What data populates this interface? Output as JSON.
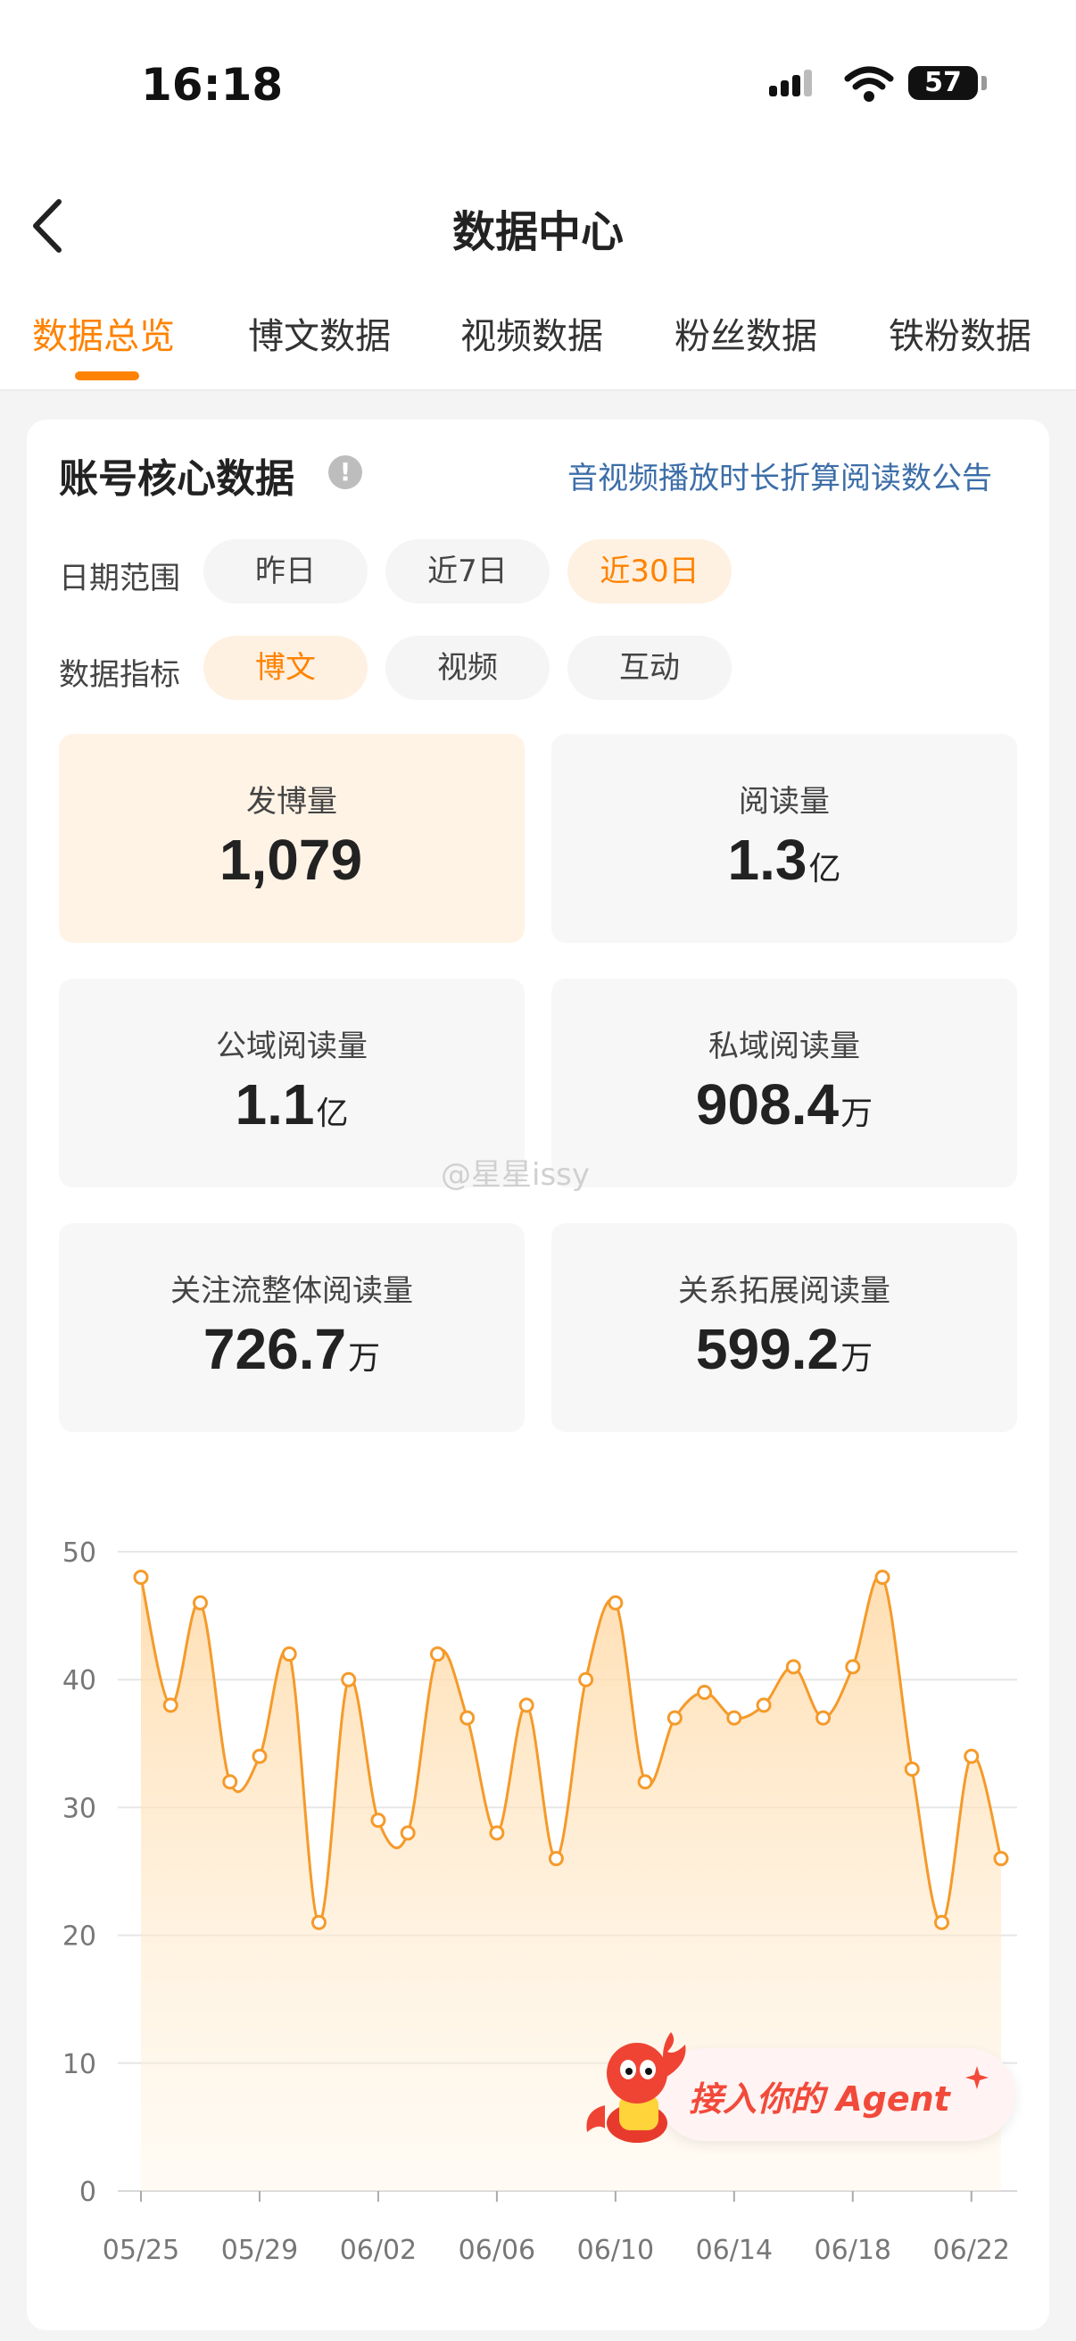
{
  "status": {
    "time": "16:18",
    "battery": "57"
  },
  "header": {
    "title": "数据中心"
  },
  "tabs": [
    {
      "label": "数据总览"
    },
    {
      "label": "博文数据"
    },
    {
      "label": "视频数据"
    },
    {
      "label": "粉丝数据"
    },
    {
      "label": "铁粉数据"
    }
  ],
  "section": {
    "title": "账号核心数据",
    "info_icon": "!",
    "notice": "音视频播放时长折算阅读数公告"
  },
  "filters": {
    "date_label": "日期范围",
    "date_options": [
      "昨日",
      "近7日",
      "近30日"
    ],
    "metric_label": "数据指标",
    "metric_options": [
      "博文",
      "视频",
      "互动"
    ]
  },
  "metrics": [
    {
      "label": "发博量",
      "value": "1,079",
      "unit": ""
    },
    {
      "label": "阅读量",
      "value": "1.3",
      "unit": "亿"
    },
    {
      "label": "公域阅读量",
      "value": "1.1",
      "unit": "亿"
    },
    {
      "label": "私域阅读量",
      "value": "908.4",
      "unit": "万"
    },
    {
      "label": "关注流整体阅读量",
      "value": "726.7",
      "unit": "万"
    },
    {
      "label": "关系拓展阅读量",
      "value": "599.2",
      "unit": "万"
    }
  ],
  "watermark": "@星星issy",
  "agent": {
    "label": "接入你的 Agent"
  },
  "colors": {
    "accent": "#ff8200",
    "link": "#3d6ea8"
  },
  "chart_data": {
    "type": "area",
    "x": [
      "05/25",
      "05/26",
      "05/27",
      "05/28",
      "05/29",
      "05/30",
      "05/31",
      "06/01",
      "06/02",
      "06/03",
      "06/04",
      "06/05",
      "06/06",
      "06/07",
      "06/08",
      "06/09",
      "06/10",
      "06/11",
      "06/12",
      "06/13",
      "06/14",
      "06/15",
      "06/16",
      "06/17",
      "06/18",
      "06/19",
      "06/20",
      "06/21",
      "06/22",
      "06/23"
    ],
    "values": [
      48,
      38,
      46,
      32,
      34,
      42,
      21,
      40,
      29,
      28,
      42,
      37,
      28,
      38,
      26,
      40,
      46,
      32,
      37,
      39,
      37,
      38,
      41,
      37,
      41,
      48,
      33,
      21,
      34,
      26
    ],
    "xticks": [
      "05/25",
      "05/29",
      "06/02",
      "06/06",
      "06/10",
      "06/14",
      "06/18",
      "06/22"
    ],
    "yticks": [
      0,
      10,
      20,
      30,
      40,
      50
    ],
    "ylim": [
      0,
      50
    ],
    "grid": true
  }
}
